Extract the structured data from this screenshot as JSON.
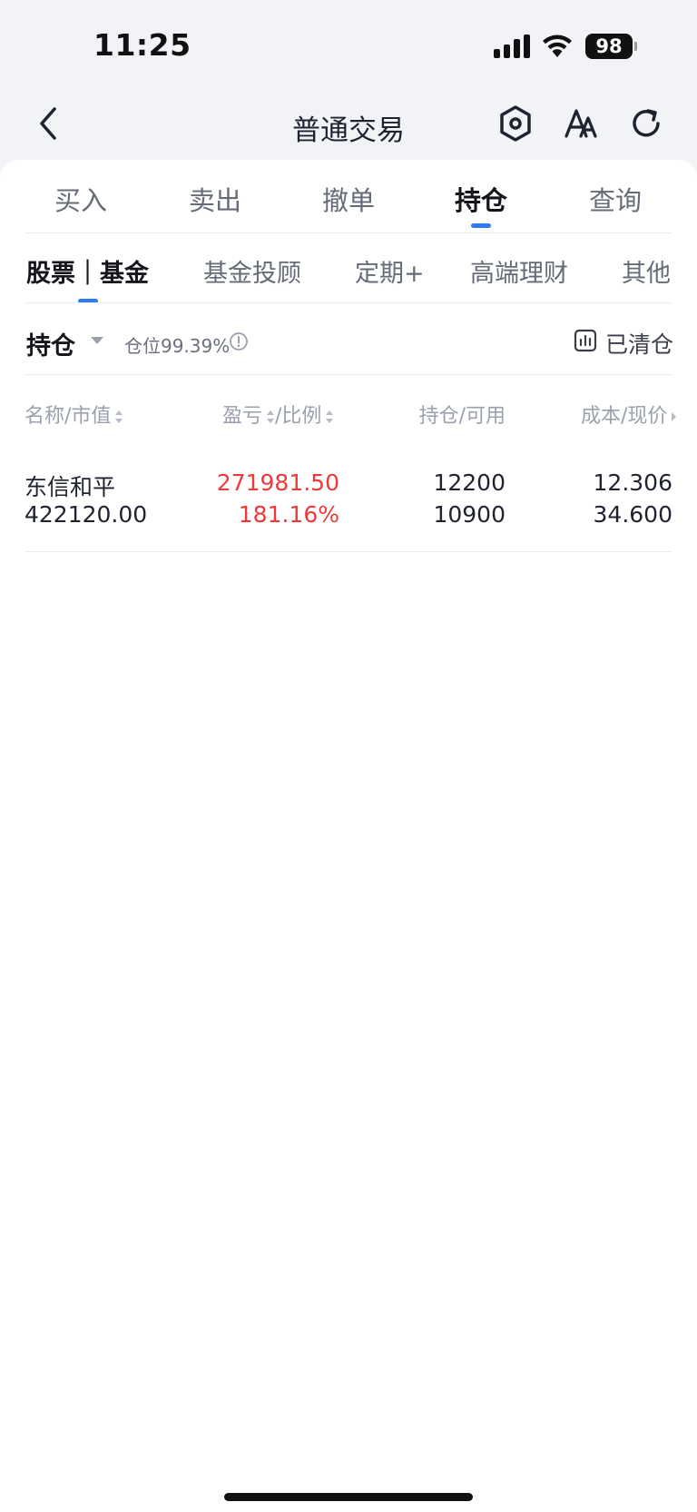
{
  "status_bar": {
    "time": "11:25",
    "battery": "98"
  },
  "nav": {
    "title": "普通交易"
  },
  "primary_tabs": [
    "买入",
    "卖出",
    "撤单",
    "持仓",
    "查询"
  ],
  "primary_active": "持仓",
  "secondary_tabs": [
    "股票｜基金",
    "基金投顾",
    "定期+",
    "高端理财",
    "其他"
  ],
  "secondary_active": "股票｜基金",
  "holdings": {
    "label": "持仓",
    "position_ratio": "仓位99.39%",
    "cleared_label": "已清仓"
  },
  "table": {
    "headers": [
      "名称/市值",
      "盈亏",
      "/比例",
      "持仓/可用",
      "成本/现价"
    ],
    "rows": [
      {
        "name": "东信和平",
        "market_value": "422120.00",
        "profit_loss": "271981.50",
        "profit_ratio": "181.16%",
        "holding": "12200",
        "available": "10900",
        "cost": "12.306",
        "current_price": "34.600"
      }
    ]
  },
  "colors": {
    "accent": "#2f7bf5",
    "profit": "#f03a3a"
  }
}
